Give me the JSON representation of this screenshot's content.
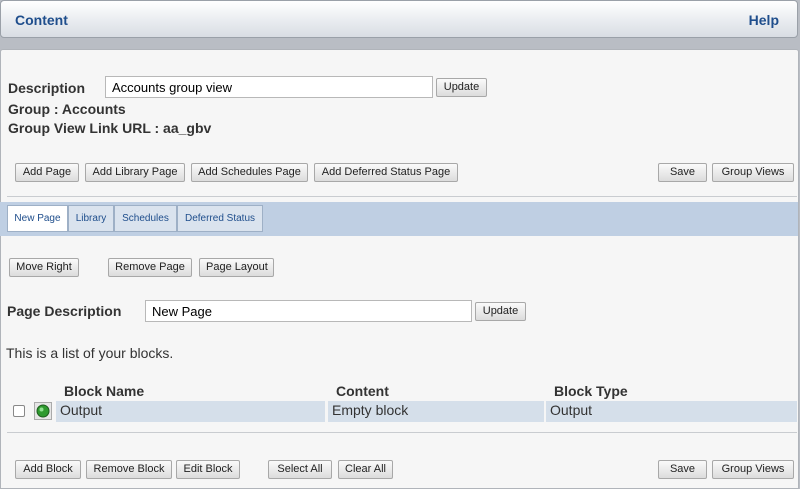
{
  "header": {
    "title": "Content",
    "help": "Help"
  },
  "group": {
    "description_label": "Description",
    "description_value": "Accounts group view",
    "update_label": "Update",
    "group_line": "Group : Accounts",
    "link_line": "Group View Link URL : aa_gbv"
  },
  "toolbar_top": {
    "add_page": "Add Page",
    "add_library_page": "Add Library Page",
    "add_schedules_page": "Add Schedules Page",
    "add_deferred_status_page": "Add Deferred Status Page",
    "save": "Save",
    "group_views": "Group Views"
  },
  "tabs": [
    "New Page",
    "Library",
    "Schedules",
    "Deferred Status"
  ],
  "page_actions": {
    "move_right": "Move Right",
    "remove_page": "Remove Page",
    "page_layout": "Page Layout"
  },
  "page": {
    "description_label": "Page Description",
    "description_value": "New Page",
    "update_label": "Update",
    "list_intro": "This is a list of your blocks."
  },
  "blocks_table": {
    "columns": [
      "Block Name",
      "Content",
      "Block Type"
    ],
    "rows": [
      {
        "name": "Output",
        "content": "Empty block",
        "type": "Output"
      }
    ]
  },
  "toolbar_bottom": {
    "add_block": "Add Block",
    "remove_block": "Remove Block",
    "edit_block": "Edit Block",
    "select_all": "Select All",
    "clear_all": "Clear All",
    "save": "Save",
    "group_views": "Group Views"
  }
}
